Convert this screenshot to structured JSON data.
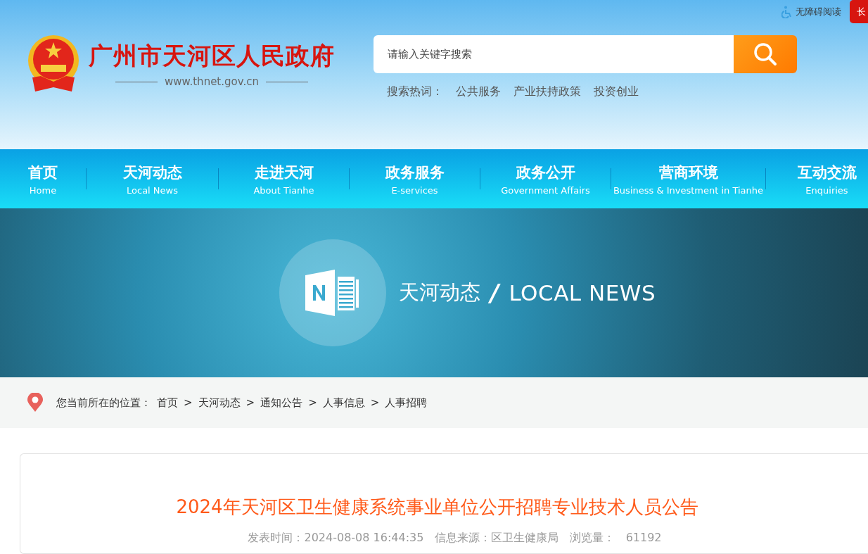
{
  "topbar": {
    "accessibility": "无障碍阅读",
    "cut_tab": "长"
  },
  "site": {
    "title": "广州市天河区人民政府",
    "url": "www.thnet.gov.cn"
  },
  "search": {
    "placeholder": "请输入关键字搜索",
    "hot_label": "搜索热词：",
    "hot_words": [
      "公共服务",
      "产业扶持政策",
      "投资创业"
    ]
  },
  "nav": [
    {
      "zh": "首页",
      "en": "Home"
    },
    {
      "zh": "天河动态",
      "en": "Local News"
    },
    {
      "zh": "走进天河",
      "en": "About Tianhe"
    },
    {
      "zh": "政务服务",
      "en": "E-services"
    },
    {
      "zh": "政务公开",
      "en": "Government Affairs"
    },
    {
      "zh": "营商环境",
      "en": "Business & Investment in Tianhe"
    },
    {
      "zh": "互动交流",
      "en": "Enquiries"
    }
  ],
  "banner": {
    "title_zh": "天河动态",
    "slash": "/",
    "title_en": "LOCAL NEWS"
  },
  "breadcrumb": {
    "label": "您当前所在的位置：",
    "separator": ">",
    "items": [
      "首页",
      "天河动态",
      "通知公告",
      "人事信息",
      "人事招聘"
    ]
  },
  "article": {
    "title": "2024年天河区卫生健康系统事业单位公开招聘专业技术人员公告",
    "meta": [
      {
        "label": "发表时间：",
        "value": "2024-08-08 16:44:35"
      },
      {
        "label": "信息来源：",
        "value": "区卫生健康局"
      },
      {
        "label": "浏览量：",
        "value": "61192"
      }
    ]
  }
}
